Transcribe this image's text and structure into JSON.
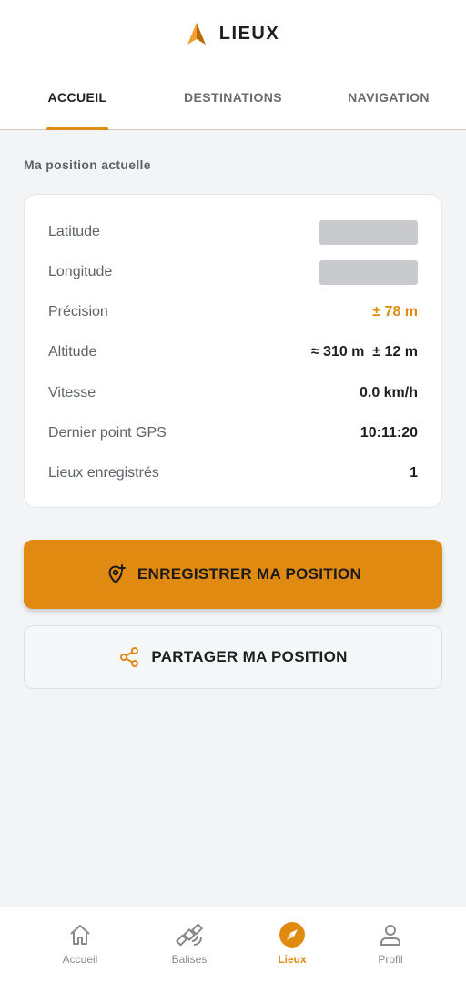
{
  "header": {
    "title": "LIEUX",
    "logo_icon": "navigation-arrow-icon"
  },
  "colors": {
    "accent": "#e08a12",
    "background": "#f3f4f6",
    "card": "#ffffff",
    "redacted": "#c8cacd"
  },
  "tabs": [
    {
      "label": "ACCUEIL",
      "active": true
    },
    {
      "label": "DESTINATIONS",
      "active": false
    },
    {
      "label": "NAVIGATION",
      "active": false
    }
  ],
  "position": {
    "section_title": "Ma position actuelle",
    "rows": [
      {
        "label": "Latitude",
        "value": "",
        "redacted": true
      },
      {
        "label": "Longitude",
        "value": "",
        "redacted": true
      },
      {
        "label": "Précision",
        "value": "± 78 m",
        "accent": true
      },
      {
        "label": "Altitude",
        "value": "≈ 310 m  ± 12 m"
      },
      {
        "label": "Vitesse",
        "value": "0.0 km/h"
      },
      {
        "label": "Dernier point GPS",
        "value": "10:11:20"
      },
      {
        "label": "Lieux enregistrés",
        "value": "1"
      }
    ]
  },
  "actions": {
    "save": {
      "label": "ENREGISTRER MA POSITION",
      "icon": "add-location-icon"
    },
    "share": {
      "label": "PARTAGER MA POSITION",
      "icon": "share-icon"
    }
  },
  "bottom_nav": [
    {
      "label": "Accueil",
      "icon": "home-icon",
      "active": false
    },
    {
      "label": "Balises",
      "icon": "satellite-icon",
      "active": false
    },
    {
      "label": "Lieux",
      "icon": "compass-icon",
      "active": true
    },
    {
      "label": "Profil",
      "icon": "profile-icon",
      "active": false
    }
  ]
}
